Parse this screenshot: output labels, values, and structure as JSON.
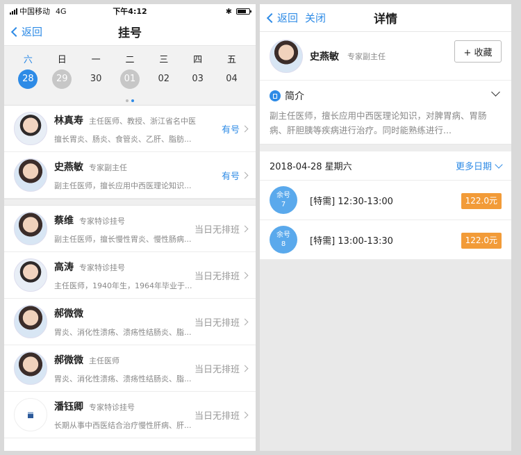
{
  "status": {
    "carrier": "中国移动",
    "network": "4G",
    "time": "下午4:12"
  },
  "left": {
    "nav": {
      "back": "返回",
      "title": "挂号"
    },
    "dates": [
      {
        "weekday": "六",
        "day": "28",
        "state": "selected"
      },
      {
        "weekday": "日",
        "day": "29",
        "state": "grey"
      },
      {
        "weekday": "一",
        "day": "30",
        "state": "normal"
      },
      {
        "weekday": "二",
        "day": "01",
        "state": "grey"
      },
      {
        "weekday": "三",
        "day": "02",
        "state": "normal"
      },
      {
        "weekday": "四",
        "day": "03",
        "state": "normal"
      },
      {
        "weekday": "五",
        "day": "04",
        "state": "normal"
      }
    ],
    "doctors": [
      {
        "name": "林真寿",
        "title": "主任医师、教授、浙江省名中医",
        "desc": "擅长胃炎、肠炎、食管炎、乙肝、脂肪...",
        "status": "有号"
      },
      {
        "name": "史燕敏",
        "title": "专家副主任",
        "desc": "副主任医师，擅长应用中西医理论知识...",
        "status": "有号"
      },
      {
        "name": "蔡维",
        "title": "专家特诊挂号",
        "desc": "副主任医师，擅长慢性胃炎、慢性肠病...",
        "status": "当日无排班"
      },
      {
        "name": "高涛",
        "title": "专家特诊挂号",
        "desc": "主任医师，1940年生，1964年毕业于...",
        "status": "当日无排班"
      },
      {
        "name": "郝微微",
        "title": "",
        "desc": "胃炎、消化性溃疡、溃疡性结肠炎、脂...",
        "status": "当日无排班"
      },
      {
        "name": "郝微微",
        "title": "主任医师",
        "desc": "胃炎、消化性溃疡、溃疡性结肠炎、脂...",
        "status": "当日无排班"
      },
      {
        "name": "潘钰卿",
        "title": "专家特诊挂号",
        "desc": "长期从事中西医结合治疗慢性肝病、肝...",
        "status": "当日无排班"
      }
    ]
  },
  "right": {
    "nav": {
      "back": "返回",
      "close": "关闭",
      "title": "详情"
    },
    "doctor": {
      "name": "史燕敏",
      "title": "专家副主任",
      "fav": "+ 收藏"
    },
    "intro": {
      "heading": "简介",
      "text": "副主任医师，擅长应用中西医理论知识，对脾胃病、胃肠病、肝胆胰等疾病进行治疗。同时能熟练进行..."
    },
    "date_label": "2018-04-28 星期六",
    "more_dates": "更多日期",
    "slots": [
      {
        "remain_label": "余号",
        "remain": "7",
        "label": "[特需] 12:30-13:00",
        "price": "122.0元"
      },
      {
        "remain_label": "余号",
        "remain": "8",
        "label": "[特需] 13:00-13:30",
        "price": "122.0元"
      }
    ]
  }
}
